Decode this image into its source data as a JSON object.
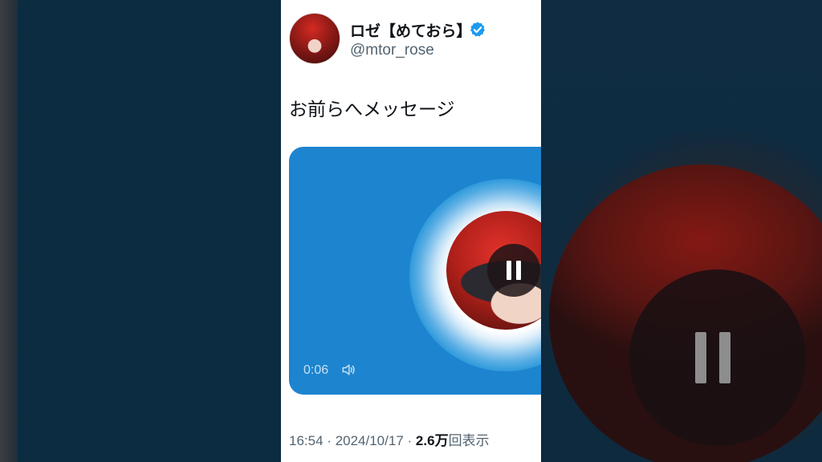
{
  "tweet": {
    "display_name": "ロゼ【めておら】",
    "handle": "@mtor_rose",
    "text": "お前らへメッセージ",
    "media": {
      "duration": "0:06",
      "playing": true
    },
    "meta": {
      "time": "16:54",
      "separator": "·",
      "date": "2024/10/17",
      "views_count": "2.6",
      "views_unit": "万",
      "views_label": "回表示"
    }
  },
  "colors": {
    "media_background": "#1d84cf",
    "verified_badge": "#1d9bf0",
    "page_background": "#0c2c42"
  },
  "icons": {
    "verified": "verified-badge-icon",
    "pause": "pause-icon",
    "volume": "volume-icon"
  }
}
